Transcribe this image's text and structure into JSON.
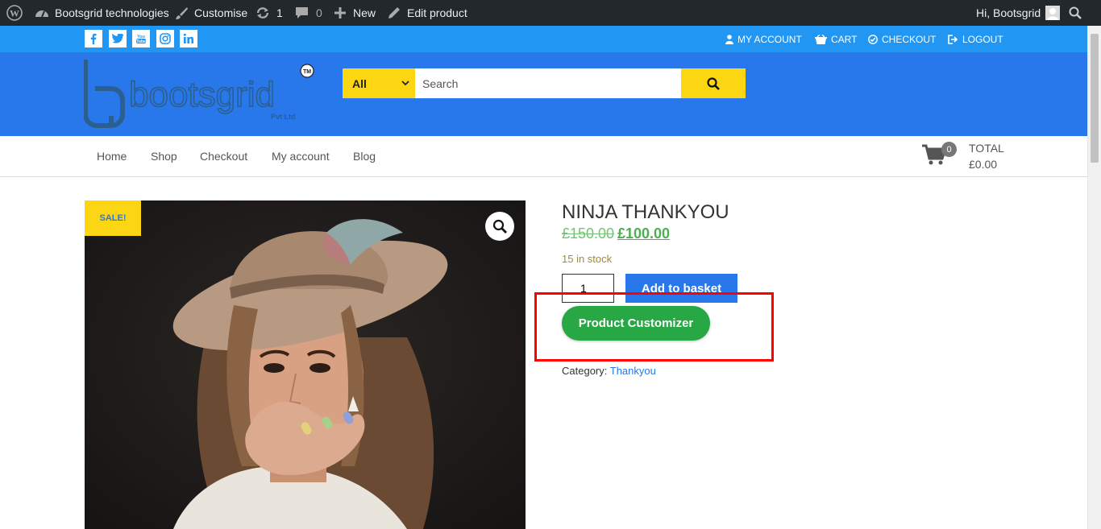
{
  "admin_bar": {
    "site_name": "Bootsgrid technologies",
    "customise": "Customise",
    "updates_count": "1",
    "comments_count": "0",
    "new_label": "New",
    "edit_label": "Edit product",
    "greeting": "Hi, Bootsgrid"
  },
  "top_strip": {
    "social": [
      "facebook-icon",
      "twitter-icon",
      "youtube-icon",
      "instagram-icon",
      "linkedin-icon"
    ],
    "links": {
      "my_account": "MY ACCOUNT",
      "cart": "CART",
      "checkout": "CHECKOUT",
      "logout": "LOGOUT"
    }
  },
  "header": {
    "logo_text": "bootsgrid",
    "logo_sub": "Pvt Ltd",
    "logo_tm": "TM",
    "search": {
      "category": "All",
      "placeholder": "Search"
    }
  },
  "nav": {
    "items": [
      "Home",
      "Shop",
      "Checkout",
      "My account",
      "Blog"
    ],
    "cart_count": "0",
    "total_label": "TOTAL",
    "total_value": "£0.00"
  },
  "product": {
    "sale_badge": "SALE!",
    "title": "NINJA THANKYOU",
    "price_old": "£150.00",
    "price_new": "£100.00",
    "stock": "15 in stock",
    "quantity": "1",
    "add_to_basket": "Add to basket",
    "customizer": "Product Customizer",
    "category_label": "Category:",
    "category_value": "Thankyou"
  },
  "colors": {
    "admin_bar": "#23282d",
    "top_strip": "#2196f3",
    "header": "#2878eb",
    "accent_yellow": "#fcd612",
    "customizer_green": "#28a745",
    "highlight_red": "#ff0000"
  }
}
